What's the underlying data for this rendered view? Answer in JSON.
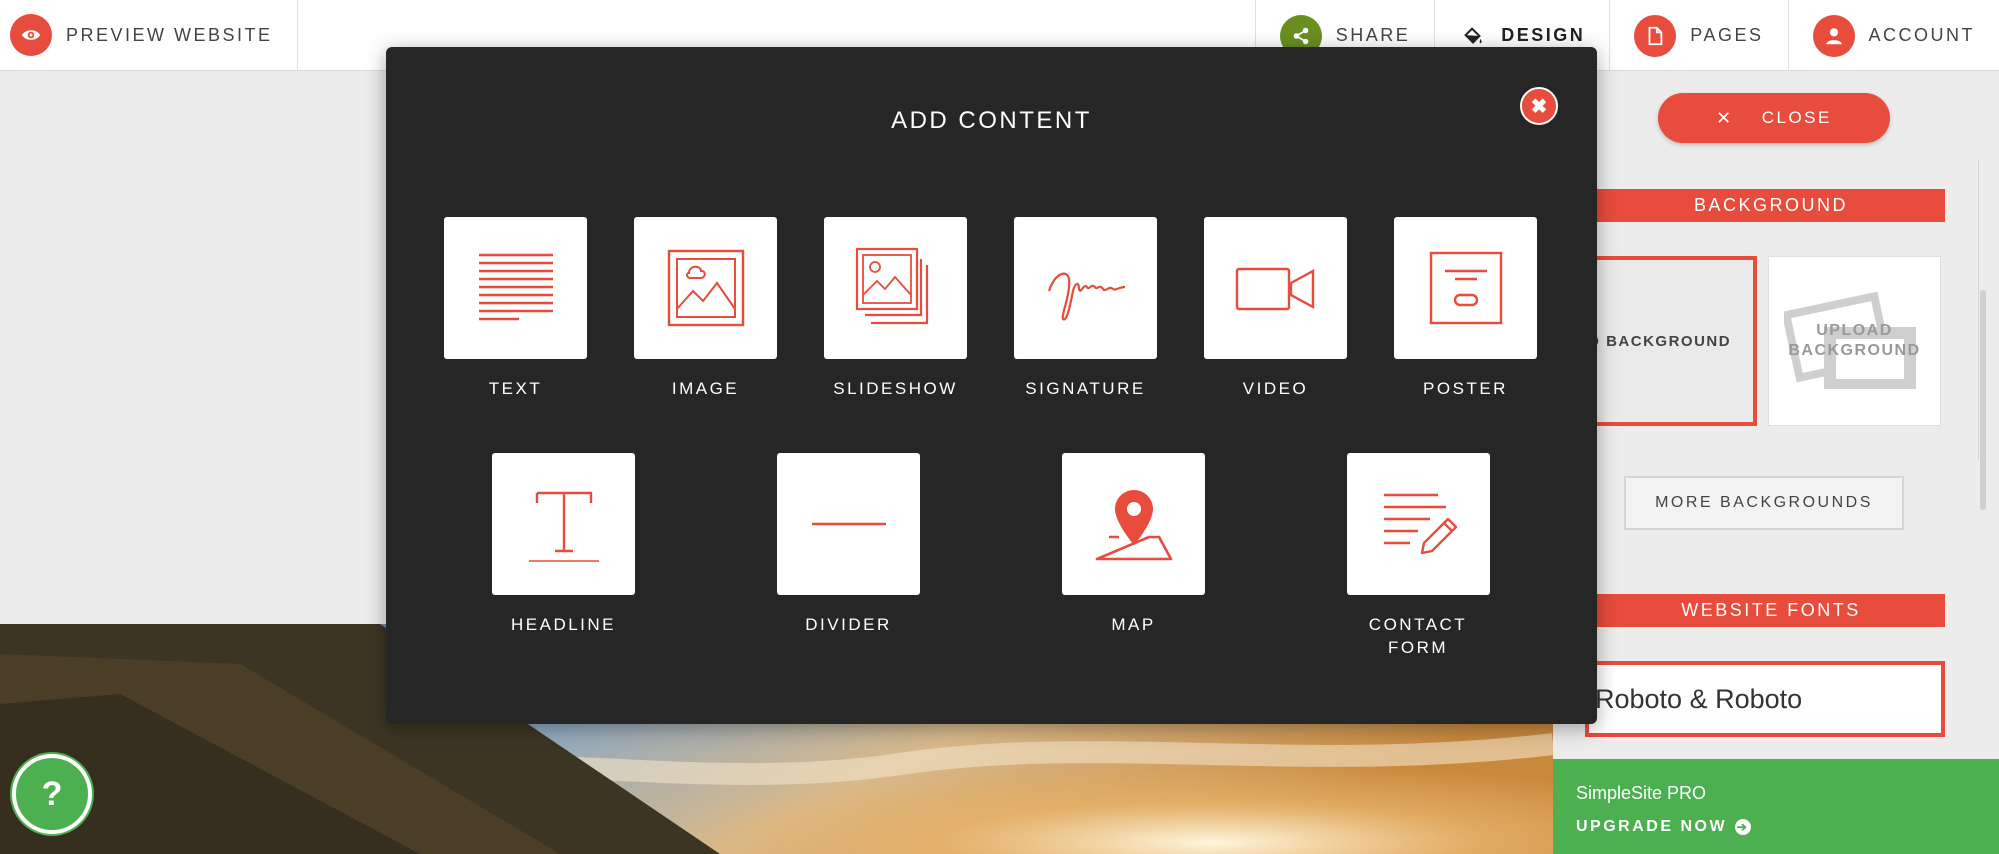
{
  "topbar": {
    "preview_label": "PREVIEW WEBSITE",
    "nav": [
      {
        "label": "SHARE",
        "icon": "share-icon"
      },
      {
        "label": "DESIGN",
        "icon": "paint-bucket-icon"
      },
      {
        "label": "PAGES",
        "icon": "page-icon"
      },
      {
        "label": "ACCOUNT",
        "icon": "user-icon"
      }
    ]
  },
  "modal": {
    "title": "ADD CONTENT",
    "items": [
      {
        "label": "TEXT",
        "icon": "text-icon"
      },
      {
        "label": "IMAGE",
        "icon": "image-icon"
      },
      {
        "label": "SLIDESHOW",
        "icon": "slideshow-icon"
      },
      {
        "label": "SIGNATURE",
        "icon": "signature-icon"
      },
      {
        "label": "VIDEO",
        "icon": "video-icon"
      },
      {
        "label": "POSTER",
        "icon": "poster-icon"
      },
      {
        "label": "HEADLINE",
        "icon": "headline-icon"
      },
      {
        "label": "DIVIDER",
        "icon": "divider-icon"
      },
      {
        "label": "MAP",
        "icon": "map-pin-icon"
      },
      {
        "label": "CONTACT FORM",
        "icon": "contact-form-icon"
      }
    ]
  },
  "panel": {
    "close_label": "CLOSE",
    "background_heading": "BACKGROUND",
    "no_background": "NO BACKGROUND",
    "upload_background": "UPLOAD BACKGROUND",
    "more_backgrounds": "MORE BACKGROUNDS",
    "fonts_heading": "WEBSITE FONTS",
    "font_value": "Roboto & Roboto",
    "pro_title": "SimpleSite PRO",
    "pro_link": "UPGRADE NOW"
  },
  "help": {
    "label": "?"
  },
  "colors": {
    "accent": "#e74c3c",
    "green": "#4caf50",
    "modal_bg": "#262626"
  }
}
